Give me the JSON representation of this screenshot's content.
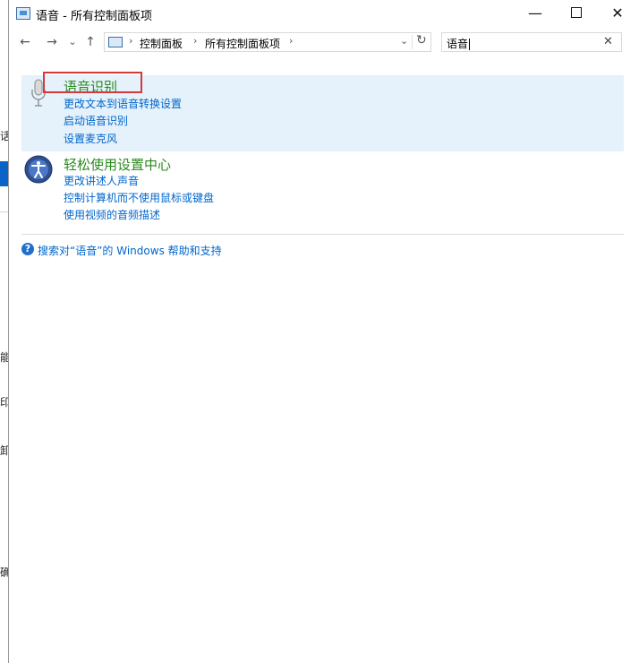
{
  "window": {
    "title": "语音 - 所有控制面板项",
    "minimize_glyph": "—",
    "close_glyph": "✕"
  },
  "nav": {
    "back_glyph": "←",
    "forward_glyph": "→",
    "recent_glyph": "⌄",
    "up_glyph": "↑"
  },
  "address": {
    "crumbs": [
      "控制面板",
      "所有控制面板项"
    ],
    "separator": "›",
    "dropdown_glyph": "⌄",
    "refresh_glyph": "↻"
  },
  "search": {
    "value": "语音",
    "clear_glyph": "✕"
  },
  "results": [
    {
      "title": "语音识别",
      "icon": "microphone-icon",
      "tasks": [
        "更改文本到语音转换设置",
        "启动语音识别",
        "设置麦克风"
      ]
    },
    {
      "title": "轻松使用设置中心",
      "icon": "ease-of-access-icon",
      "tasks": [
        "更改讲述人声音",
        "控制计算机而不使用鼠标或键盘",
        "使用视频的音频描述"
      ]
    }
  ],
  "help": {
    "icon_glyph": "?",
    "text": "搜索对“语音”的 Windows 帮助和支持"
  },
  "background_window": {
    "fragments": [
      "话",
      "能",
      "印",
      "卸",
      "确"
    ]
  },
  "colors": {
    "accent_link": "#0066cc",
    "category_title": "#2a8a1e",
    "highlight_bg": "#e5f1fb",
    "annotation_red": "#d43a3a"
  }
}
